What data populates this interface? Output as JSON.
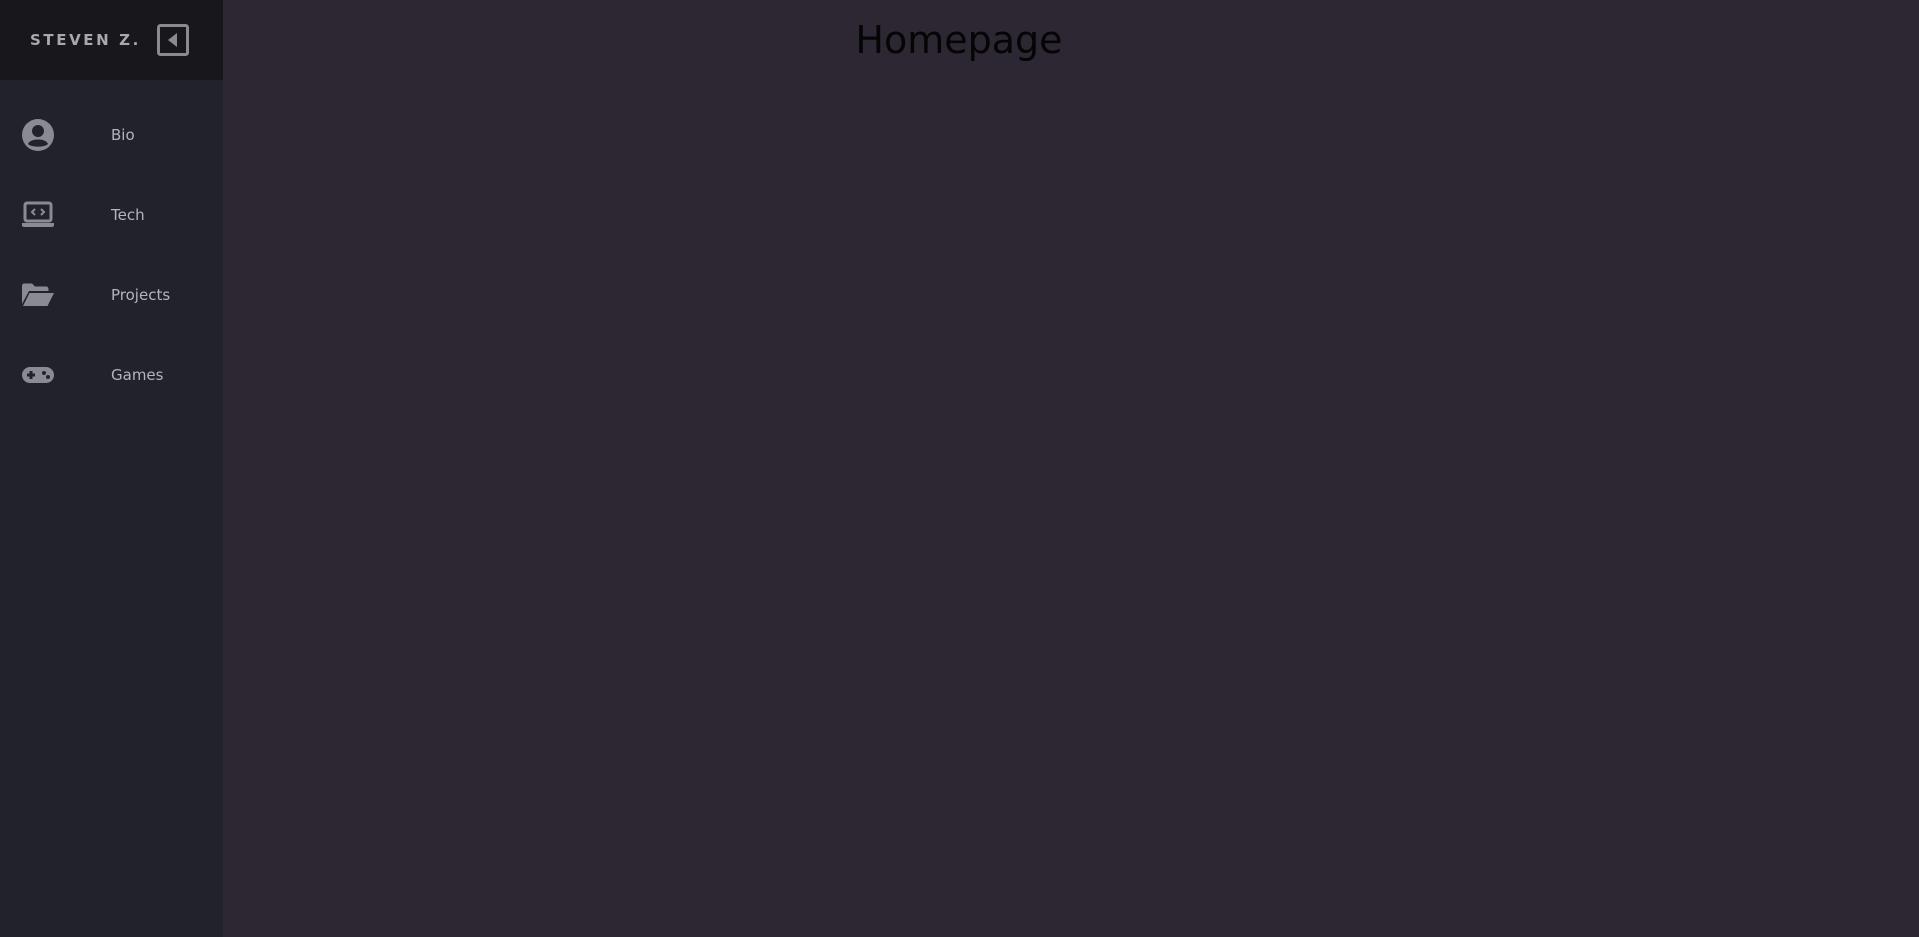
{
  "sidebar": {
    "brand": "STEVEN Z.",
    "collapse_icon": "caret-left-square-icon",
    "items": [
      {
        "label": "Bio",
        "icon": "user-circle-icon"
      },
      {
        "label": "Tech",
        "icon": "laptop-code-icon"
      },
      {
        "label": "Projects",
        "icon": "folder-open-icon"
      },
      {
        "label": "Games",
        "icon": "gamepad-icon"
      }
    ]
  },
  "main": {
    "title": "Homepage"
  },
  "colors": {
    "page_background": "#2d2734",
    "sidebar_background": "#22222c",
    "sidebar_header_background": "#17171c",
    "icon_color": "#8a8a92",
    "nav_text": "#b4b4bc",
    "title_text": "#050505"
  }
}
